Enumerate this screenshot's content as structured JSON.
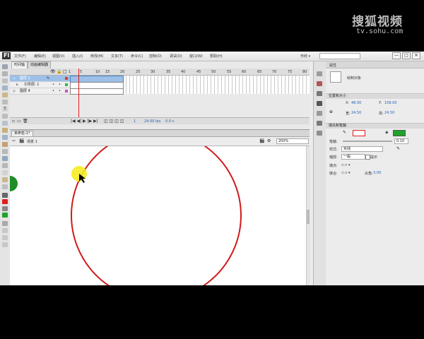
{
  "watermark": {
    "main": "搜狐视频",
    "sub": "tv.sohu.com"
  },
  "app": {
    "logo": "Fl",
    "menus": [
      "文件(F)",
      "编辑(E)",
      "视图(V)",
      "插入(I)",
      "修改(M)",
      "文本(T)",
      "命令(C)",
      "控制(O)",
      "调试(D)",
      "窗口(W)",
      "帮助(H)"
    ],
    "workspace": "传统 ▾",
    "window_buttons": [
      "—",
      "□",
      "✕"
    ]
  },
  "timeline": {
    "tabs": [
      "时间轴",
      "动画编辑器"
    ],
    "ruler": [
      "1",
      "5",
      "10",
      "15",
      "20",
      "25",
      "30",
      "35",
      "40",
      "45",
      "50",
      "55",
      "60",
      "65",
      "70",
      "75",
      "80"
    ],
    "layers": [
      {
        "name": "图层 2",
        "selected": true
      },
      {
        "name": "引导层: 1",
        "selected": false
      },
      {
        "name": "图层 4",
        "selected": false
      }
    ],
    "footer": {
      "fps": "24.00 fps",
      "time": "0.0 s",
      "frame": "1"
    }
  },
  "document": {
    "tab": "未命名-1*",
    "scene": "场景 1",
    "zoom": "200%"
  },
  "properties": {
    "tab": "属性",
    "object_type": "绘制对象",
    "position_section": "位置和大小",
    "x_label": "X:",
    "x_value": "48.00",
    "y_label": "Y:",
    "y_value": "158.00",
    "w_label": "宽:",
    "w_value": "24.50",
    "h_label": "高:",
    "h_value": "24.50",
    "fill_section": "填充和笔触",
    "stroke_label": "笔触:",
    "stroke_value": "0.10",
    "style_label": "样式:",
    "style_value": "实线",
    "scale_label": "缩放:",
    "scale_value": "一般",
    "hint_label": "提示",
    "cap_label": "端点:",
    "join_label": "接合:",
    "miter_label": "尖角:",
    "miter_value": "3.00",
    "stroke_color": "#e01d1d",
    "fill_color": "#1fa32a"
  }
}
